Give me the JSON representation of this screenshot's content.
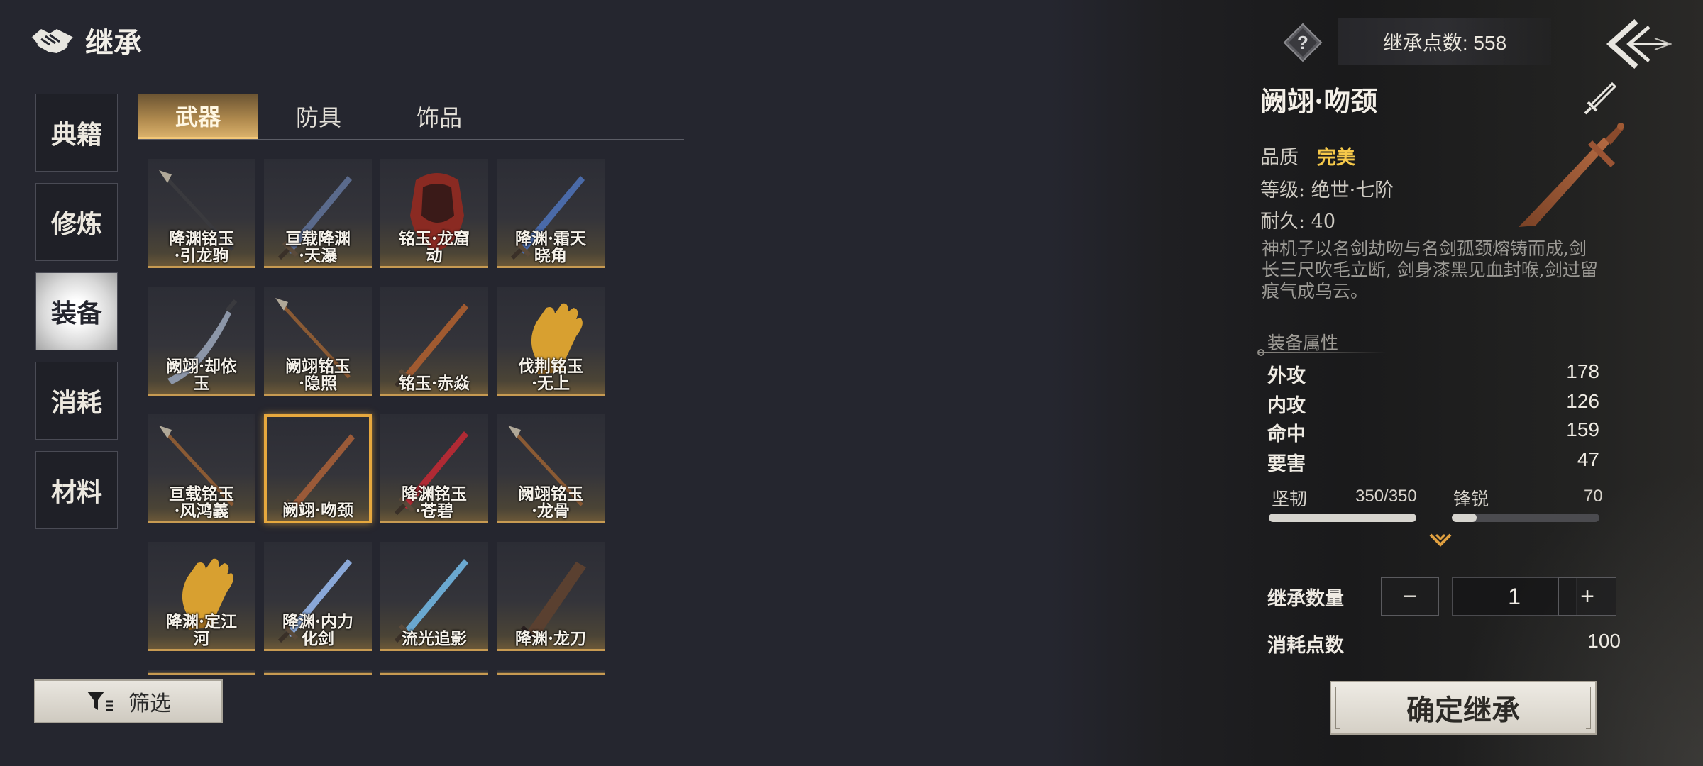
{
  "header": {
    "title": "继承",
    "icon": "handshake-icon"
  },
  "sidebar": {
    "items": [
      {
        "label": "典籍",
        "active": false
      },
      {
        "label": "修炼",
        "active": false
      },
      {
        "label": "装备",
        "active": true
      },
      {
        "label": "消耗",
        "active": false
      },
      {
        "label": "材料",
        "active": false
      }
    ]
  },
  "tabs": [
    {
      "label": "武器",
      "active": true
    },
    {
      "label": "防具",
      "active": false
    },
    {
      "label": "饰品",
      "active": false
    }
  ],
  "grid": {
    "items": [
      {
        "name": "降渊铭玉\n·引龙驹",
        "icon": "spear-icon",
        "color": "#3a3a3e"
      },
      {
        "name": "亘载降渊\n·天瀑",
        "icon": "sword-icon",
        "color": "#5a6a8c"
      },
      {
        "name": "铭玉·龙窟\n动",
        "icon": "gauntlet-icon",
        "color": "#8a2a22"
      },
      {
        "name": "降渊·霜天\n晓角",
        "icon": "sword-icon",
        "color": "#4a6aa8"
      },
      {
        "name": "阙翊·却依\n玉",
        "icon": "saber-icon",
        "color": "#8c96a8"
      },
      {
        "name": "阙翊铭玉\n·隐照",
        "icon": "spear-icon",
        "color": "#8a5a34"
      },
      {
        "name": "铭玉·赤焱",
        "icon": "sword-icon",
        "color": "#a05a30"
      },
      {
        "name": "伐荆铭玉\n·无上",
        "icon": "glove-icon",
        "color": "#d8a030"
      },
      {
        "name": "亘载铭玉\n·风鸿義",
        "icon": "spear-icon",
        "color": "#8a5a34"
      },
      {
        "name": "阙翊·吻颈",
        "icon": "sword-icon",
        "color": "#9a5a38"
      },
      {
        "name": "降渊铭玉\n·苍碧",
        "icon": "sword-icon",
        "color": "#b02a34"
      },
      {
        "name": "阙翊铭玉\n·龙骨",
        "icon": "spear-icon",
        "color": "#8a5a34"
      },
      {
        "name": "降渊·定江\n河",
        "icon": "glove-icon",
        "color": "#d8a030"
      },
      {
        "name": "降渊·内力\n化剑",
        "icon": "sword-icon",
        "color": "#8aa8d8"
      },
      {
        "name": "流光追影",
        "icon": "sword-icon",
        "color": "#6aa8d0"
      },
      {
        "name": "降渊·龙刀",
        "icon": "blade-icon",
        "color": "#5a4030"
      }
    ],
    "selected_index": 9
  },
  "filter": {
    "label": "筛选",
    "icon": "filter-icon"
  },
  "top_bar": {
    "help_icon": "question-icon",
    "points_text": "继承点数: 558",
    "back_icon": "back-arrow-icon"
  },
  "detail": {
    "name": "阙翊·吻颈",
    "equip_icon": "sword-outline-icon",
    "quality_label": "品质",
    "quality_value": "完美",
    "level_text": "等级: 绝世·七阶",
    "durability_text": "耐久: 40",
    "description": "神机子以名剑劫吻与名剑孤颈熔铸而成,剑长三尺吹毛立断, 剑身漆黑见血封喉,剑过留痕气成乌云。",
    "attr_title": "装备属性",
    "stats": [
      {
        "name": "外攻",
        "value": "178"
      },
      {
        "name": "内攻",
        "value": "126"
      },
      {
        "name": "命中",
        "value": "159"
      },
      {
        "name": "要害",
        "value": "47"
      }
    ],
    "bars": [
      {
        "name": "坚韧",
        "value_text": "350/350",
        "fraction": 1.0
      },
      {
        "name": "锋锐",
        "value_text": "70",
        "fraction": 0.17
      }
    ],
    "expand_icon": "chevron-down-icon",
    "qty_label": "继承数量",
    "qty_minus": "−",
    "qty_value": "1",
    "qty_plus": "+",
    "cost_label": "消耗点数",
    "cost_value": "100",
    "confirm_label": "确定继承"
  },
  "colors": {
    "accent": "#e7a83e",
    "quality": "#f6c94a",
    "bg": "#25262f"
  }
}
